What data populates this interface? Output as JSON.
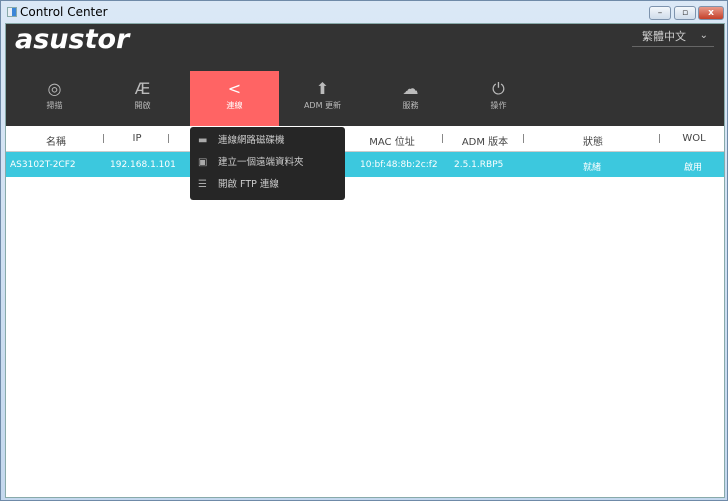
{
  "window": {
    "title": "Control Center",
    "minimize": "–",
    "maximize": "▫",
    "close": "x"
  },
  "header": {
    "logo": "asustor",
    "language": "繁體中文"
  },
  "tabs": [
    {
      "label": "掃描",
      "icon": "scan-icon",
      "glyph": "◎"
    },
    {
      "label": "開啟",
      "icon": "adm-logo-icon",
      "glyph": "Æ"
    },
    {
      "label": "連線",
      "icon": "share-icon",
      "glyph": "<"
    },
    {
      "label": "ADM 更新",
      "icon": "upload-arrow-icon",
      "glyph": "⬆"
    },
    {
      "label": "服務",
      "icon": "cloud-device-icon",
      "glyph": "☁"
    },
    {
      "label": "操作",
      "icon": "power-icon",
      "glyph": "⏻"
    }
  ],
  "table": {
    "columns": [
      "名稱",
      "IP",
      "MAC 位址",
      "ADM 版本",
      "狀態",
      "WOL"
    ],
    "rows": [
      {
        "name": "AS3102T-2CF2",
        "ip": "192.168.1.101",
        "mac": "10:bf:48:8b:2c:f2",
        "adm": "2.5.1.RBP5",
        "status": "就緒",
        "wol": "啟用"
      }
    ]
  },
  "connect_menu": [
    {
      "label": "連線網路磁碟機",
      "icon": "network-drive-icon",
      "glyph": "▬"
    },
    {
      "label": "建立一個遠端資料夾",
      "icon": "remote-folder-icon",
      "glyph": "▣"
    },
    {
      "label": "開啟 FTP 連線",
      "icon": "ftp-icon",
      "glyph": "☰"
    }
  ],
  "colors": {
    "accent": "#ff6464",
    "selected_row": "#3cc8de",
    "header_bg": "#333333"
  }
}
